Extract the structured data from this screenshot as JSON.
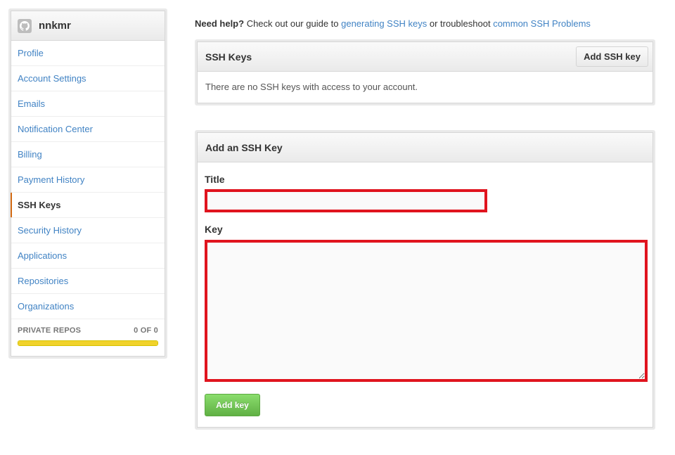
{
  "sidebar": {
    "username": "nnkmr",
    "avatar_icon": "octocat-icon",
    "items": [
      {
        "label": "Profile"
      },
      {
        "label": "Account Settings"
      },
      {
        "label": "Emails"
      },
      {
        "label": "Notification Center"
      },
      {
        "label": "Billing"
      },
      {
        "label": "Payment History"
      },
      {
        "label": "SSH Keys",
        "active": true
      },
      {
        "label": "Security History"
      },
      {
        "label": "Applications"
      },
      {
        "label": "Repositories"
      },
      {
        "label": "Organizations"
      }
    ],
    "private_repos": {
      "label": "PRIVATE REPOS",
      "count": "0 OF 0",
      "fill_fraction": 1.0
    }
  },
  "help": {
    "lead": "Need help?",
    "text1": " Check out our guide to ",
    "link1": "generating SSH keys",
    "text2": " or troubleshoot ",
    "link2": "common SSH Problems"
  },
  "ssh_keys_box": {
    "title": "SSH Keys",
    "add_button": "Add SSH key",
    "empty_message": "There are no SSH keys with access to your account."
  },
  "add_key_form": {
    "title": "Add an SSH Key",
    "title_label": "Title",
    "title_value": "",
    "key_label": "Key",
    "key_value": "",
    "submit": "Add key"
  },
  "colors": {
    "link": "#4183c4",
    "highlight_border": "#e0141e",
    "active_marker": "#d26911",
    "progress": "#f1d22a",
    "submit_green": "#60b044"
  }
}
